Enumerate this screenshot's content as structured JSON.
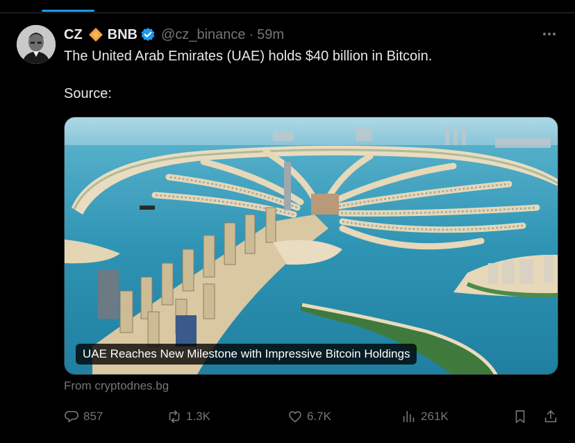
{
  "tweet": {
    "display_name": "CZ",
    "badge_label": "BNB",
    "handle": "@cz_binance",
    "separator": "·",
    "time": "59m",
    "text_line1": "The United Arab Emirates (UAE) holds $40 billion in Bitcoin.",
    "text_line2": "Source:"
  },
  "card": {
    "title": "UAE Reaches New Milestone with Impressive Bitcoin Holdings",
    "domain": "From cryptodnes.bg"
  },
  "actions": {
    "replies": "857",
    "reposts": "1.3K",
    "likes": "6.7K",
    "views": "261K"
  },
  "icons": {
    "badge": "bnb-diamond-icon",
    "verified": "verified-badge-icon",
    "more": "more-options-icon",
    "reply": "reply-icon",
    "repost": "repost-icon",
    "like": "heart-icon",
    "views": "views-chart-icon",
    "bookmark": "bookmark-icon",
    "share": "share-icon"
  },
  "colors": {
    "background": "#000000",
    "text_primary": "#e7e9ea",
    "text_secondary": "#71767b",
    "accent": "#1d9bf0",
    "bnb_orange": "#f3a23c",
    "verified_blue": "#1d9bf0"
  }
}
